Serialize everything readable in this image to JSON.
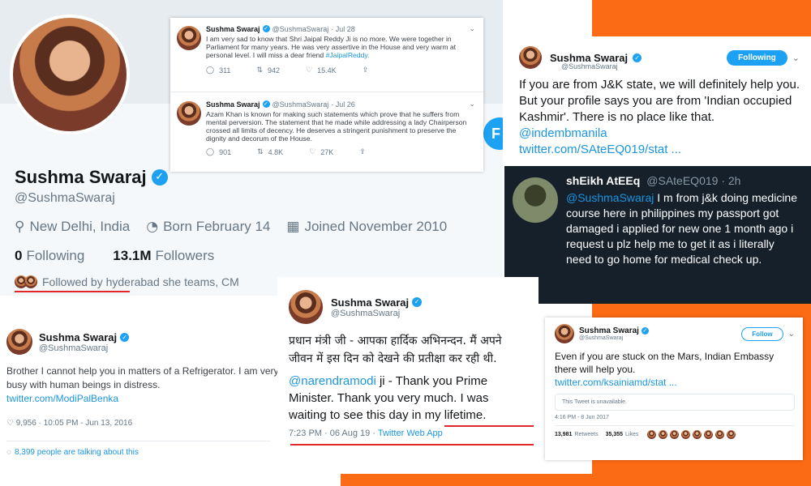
{
  "profile": {
    "name": "Sushma Swaraj",
    "handle": "@SushmaSwaraj",
    "location": "New Delhi, India",
    "born": "Born February 14",
    "joined": "Joined November 2010",
    "following_count": "0",
    "following_label": "Following",
    "followers_count": "13.1M",
    "followers_label": "Followers",
    "followed_by": "Followed by hyderabad she teams, CM"
  },
  "tweet_jaipal": {
    "name": "Sushma Swaraj",
    "handle": "@SushmaSwaraj",
    "date": "· Jul 28",
    "text": "I am very sad to know that Shri Jaipal Reddy Ji is no more. We were together in Parliament for many years. He was very assertive in the House and very warm at personal level. I will miss a dear friend ",
    "hashtag": "#JaipalReddy.",
    "replies": "311",
    "retweets": "942",
    "likes": "15.4K"
  },
  "tweet_azam": {
    "name": "Sushma Swaraj",
    "handle": "@SushmaSwaraj",
    "date": "· Jul 26",
    "text": "Azam Khan is known for making such statements which prove that he suffers from mental perversion. The statement that he made while addressing a lady Chairperson crossed all limits of decency. He deserves a stringent punishment to preserve the dignity and decorum of the House.",
    "replies": "901",
    "retweets": "4.8K",
    "likes": "27K"
  },
  "tweet_jk": {
    "name": "Sushma Swaraj",
    "handle": "@SushmaSwaraj",
    "button": "Following",
    "text": "If you are from J&K state, we will definitely help you. But your profile says you are from 'Indian occupied Kashmir'. There is no place like that. ",
    "mention": "@indembmanila",
    "link": "twitter.com/SAteEQ019/stat ..."
  },
  "tweet_sheikh": {
    "name": "shEikh AtEEq",
    "handle": "@SAteEQ019 · 2h",
    "mention": "@SushmaSwaraj",
    "text": " I m from j&k doing medicine course here in philippines  my passport got damaged i applied for new one 1 month ago i request u plz help me to get it as i literally need to go home for medical check up."
  },
  "tweet_fridge": {
    "name": "Sushma Swaraj",
    "handle": "@SushmaSwaraj",
    "text": "Brother I cannot help you in matters of a Refrigerator. I am very busy with human beings in distress.",
    "link": "twitter.com/ModiPalBenka",
    "meta": "♡ 9,956 · 10:05 PM - Jun 13, 2016",
    "talking": "8,399 people are talking about this"
  },
  "tweet_modi": {
    "name": "Sushma Swaraj",
    "handle": "@SushmaSwaraj",
    "hindi": "प्रधान मंत्री जी - आपका हार्दिक अभिनन्दन. मैं अपने जीवन में इस दिन को देखने की प्रतीक्षा कर रही थी.",
    "mention": "@narendramodi",
    "text": " ji - Thank you Prime Minister. Thank you very much. I was waiting to see this day in my lifetime.",
    "meta": "7:23 PM · 06 Aug 19 · ",
    "app": "Twitter Web App"
  },
  "tweet_mars": {
    "name": "Sushma Swaraj",
    "handle": "@SushmaSwaraj",
    "button": "Follow",
    "text": "Even if you are stuck on the Mars, Indian Embassy there will help you.",
    "link": "twitter.com/ksainiamd/stat ...",
    "unavailable": "This Tweet is unavailable.",
    "time": "4:16 PM - 8 Jun 2017",
    "retweets": "13,981",
    "retweets_label": "Retweets",
    "likes": "35,355",
    "likes_label": "Likes"
  },
  "colors": {
    "accent": "#1da1f2",
    "link": "#1b95e0",
    "orange": "#fb6a15",
    "dark_card": "#15202b",
    "underline": "#e0282a"
  }
}
